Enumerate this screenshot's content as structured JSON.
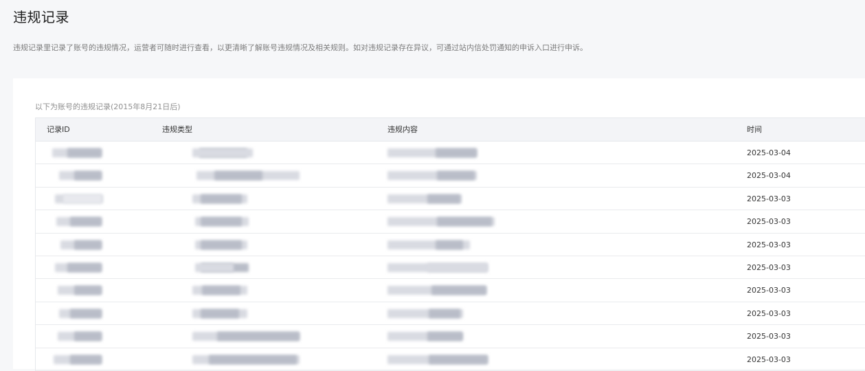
{
  "page": {
    "title": "违规记录",
    "description": "违规记录里记录了账号的违规情况，运营者可随时进行查看，以更清晰了解账号违规情况及相关规则。如对违规记录存在异议，可通过站内信处罚通知的申诉入口进行申诉。"
  },
  "records": {
    "caption": "以下为账号的违规记录(2015年8月21日后)",
    "columns": [
      "记录ID",
      "违规类型",
      "违规内容",
      "时间"
    ],
    "rows": [
      {
        "time": "2025-03-04"
      },
      {
        "time": "2025-03-04"
      },
      {
        "time": "2025-03-03"
      },
      {
        "time": "2025-03-03"
      },
      {
        "time": "2025-03-03"
      },
      {
        "time": "2025-03-03"
      },
      {
        "time": "2025-03-03"
      },
      {
        "time": "2025-03-03"
      },
      {
        "time": "2025-03-03"
      },
      {
        "time": "2025-03-03"
      }
    ]
  }
}
